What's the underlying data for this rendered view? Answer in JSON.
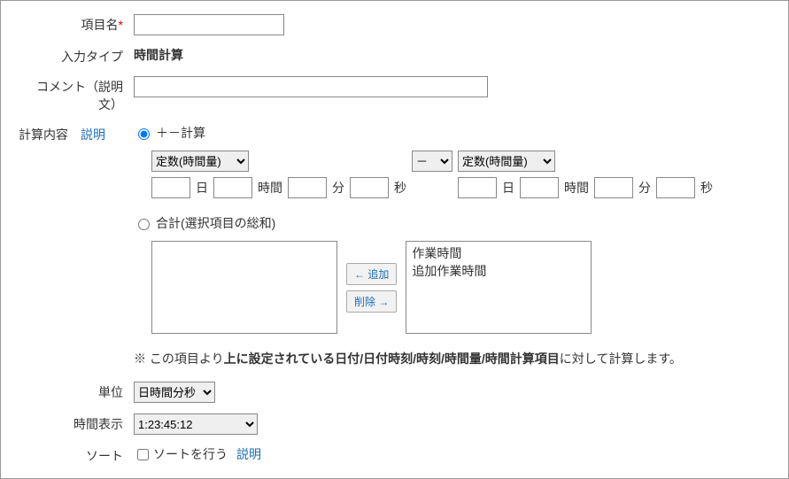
{
  "labels": {
    "item_name": "項目名",
    "input_type": "入力タイプ",
    "comment": "コメント（説明文）",
    "calc_content": "計算内容",
    "explain": "説明",
    "unit": "単位",
    "time_display": "時間表示",
    "sort": "ソート"
  },
  "values": {
    "input_type": "時間計算",
    "item_name": "",
    "comment": ""
  },
  "radios": {
    "plus_minus": "＋－計算",
    "sum": "合計(選択項目の総和)"
  },
  "selects": {
    "const1": "定数(時間量)",
    "operator": "－",
    "const2": "定数(時間量)"
  },
  "time_units": {
    "day": "日",
    "hour": "時間",
    "minute": "分",
    "second": "秒"
  },
  "buttons": {
    "add": "← 追加",
    "remove": "削除 →"
  },
  "available_items": [
    "作業時間",
    "追加作業時間"
  ],
  "note_prefix": "※ この項目より",
  "note_bold": "上に設定されている日付/日付時刻/時刻/時間量/時間計算項目",
  "note_suffix": "に対して計算します。",
  "unit_value": "日時間分秒",
  "display_value": "1:23:45:12",
  "sort_label": "ソートを行う"
}
